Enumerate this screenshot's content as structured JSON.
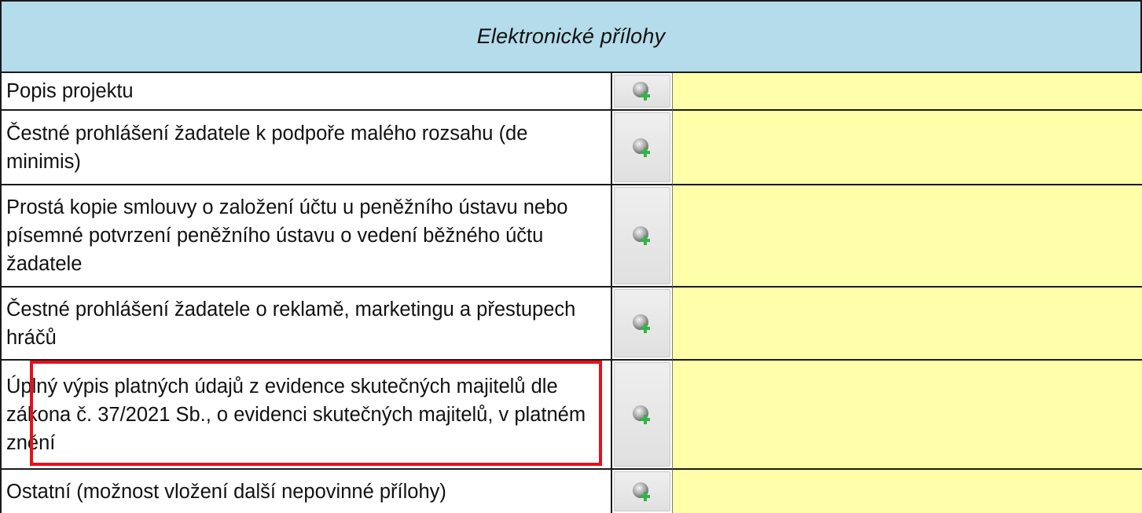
{
  "header": {
    "title": "Elektronické přílohy"
  },
  "colors": {
    "header_bg": "#b4dcea",
    "value_bg": "#ffffaa",
    "highlight": "#e8101c",
    "add_icon_plus": "#34b24a"
  },
  "rows": [
    {
      "label": "Popis projektu",
      "icon": "attach-add-icon"
    },
    {
      "label": "Čestné prohlášení žadatele k podpoře malého rozsahu (de minimis)",
      "icon": "attach-add-icon"
    },
    {
      "label": "Prostá kopie smlouvy o založení účtu u peněžního ústavu nebo písemné potvrzení peněžního ústavu o vedení běžného účtu žadatele",
      "icon": "attach-add-icon"
    },
    {
      "label": "Čestné prohlášení žadatele o reklamě, marketingu a přestupech hráčů",
      "icon": "attach-add-icon"
    },
    {
      "label": "Úplný výpis platných údajů z evidence skutečných majitelů dle zákona č. 37/2021 Sb., o evidenci skutečných majitelů, v platném znění",
      "icon": "attach-add-icon",
      "highlighted": true
    },
    {
      "label": "Ostatní (možnost vložení další nepovinné přílohy)",
      "icon": "attach-add-icon"
    }
  ]
}
